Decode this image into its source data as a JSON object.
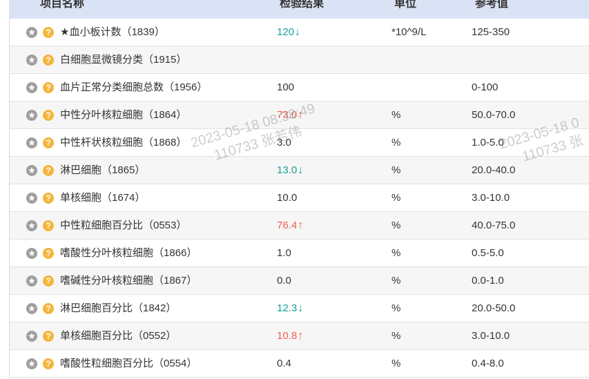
{
  "table": {
    "columns": [
      "项目名称",
      "检验结果",
      "单位",
      "参考值"
    ],
    "rows": [
      {
        "name": "★血小板计数（1839）",
        "result": "120",
        "flag": "↓",
        "unit": "*10^9/L",
        "range": "125-350"
      },
      {
        "name": "白细胞显微镜分类（1915）",
        "result": "",
        "flag": "",
        "unit": "",
        "range": ""
      },
      {
        "name": "血片正常分类细胞总数（1956）",
        "result": "100",
        "flag": "",
        "unit": "",
        "range": "0-100"
      },
      {
        "name": "中性分叶核粒细胞（1864）",
        "result": "73.0",
        "flag": "↑",
        "unit": "%",
        "range": "50.0-70.0"
      },
      {
        "name": "中性杆状核粒细胞（1868）",
        "result": "3.0",
        "flag": "",
        "unit": "%",
        "range": "1.0-5.0"
      },
      {
        "name": "淋巴细胞（1865）",
        "result": "13.0",
        "flag": "↓",
        "unit": "%",
        "range": "20.0-40.0"
      },
      {
        "name": "单核细胞（1674）",
        "result": "10.0",
        "flag": "",
        "unit": "%",
        "range": "3.0-10.0"
      },
      {
        "name": "中性粒细胞百分比（0553）",
        "result": "76.4",
        "flag": "↑",
        "unit": "%",
        "range": "40.0-75.0"
      },
      {
        "name": "嗜酸性分叶核粒细胞（1866）",
        "result": "1.0",
        "flag": "",
        "unit": "%",
        "range": "0.5-5.0"
      },
      {
        "name": "嗜碱性分叶核粒细胞（1867）",
        "result": "0.0",
        "flag": "",
        "unit": "%",
        "range": "0.0-1.0"
      },
      {
        "name": "淋巴细胞百分比（1842）",
        "result": "12.3",
        "flag": "↓",
        "unit": "%",
        "range": "20.0-50.0"
      },
      {
        "name": "单核细胞百分比（0552）",
        "result": "10.8",
        "flag": "↑",
        "unit": "%",
        "range": "3.0-10.0"
      },
      {
        "name": "嗜酸性粒细胞百分比（0554）",
        "result": "0.4",
        "flag": "",
        "unit": "%",
        "range": "0.4-8.0"
      }
    ]
  },
  "watermark": [
    {
      "line1": "2023-05-18 08:38:49",
      "line2": "110733 张若伟"
    },
    {
      "line1": "2023-05-18 0",
      "line2": "110733 张"
    }
  ],
  "icons": {
    "favorite": "star-icon",
    "help": "question-icon",
    "help_glyph": "?"
  },
  "colors": {
    "header_bg": "#dae3f5",
    "flag_high": "#ee5f4e",
    "flag_low": "#17a097",
    "star_icon": "#9e9e9e",
    "help_icon": "#f5b53b"
  }
}
